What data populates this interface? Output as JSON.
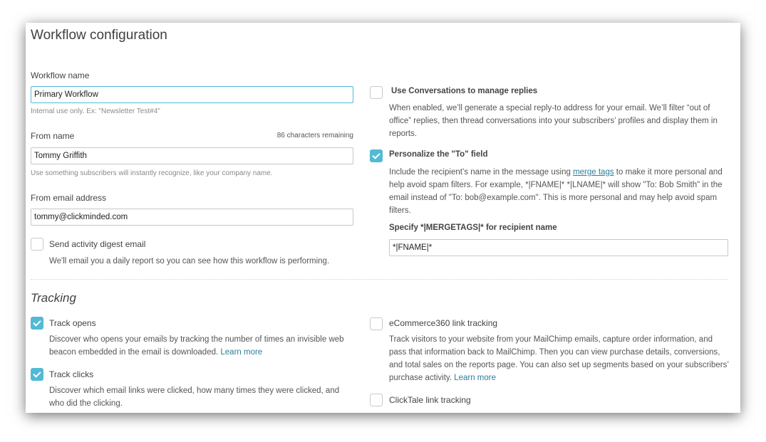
{
  "title": "Workflow configuration",
  "workflow_name": {
    "label": "Workflow name",
    "value": "Primary Workflow",
    "hint": "Internal use only. Ex: \"Newsletter Test#4\""
  },
  "from_name": {
    "label": "From name",
    "remaining": "86 characters remaining",
    "value": "Tommy Griffith",
    "hint": "Use something subscribers will instantly recognize, like your company name."
  },
  "from_email": {
    "label": "From email address",
    "value": "tommy@clickminded.com"
  },
  "digest": {
    "label": "Send activity digest email",
    "checked": false,
    "desc": "We'll email you a daily report so you can see how this workflow is performing."
  },
  "conversations": {
    "label": "Use Conversations to manage replies",
    "checked": false,
    "desc": "When enabled, we’ll generate a special reply-to address for your email. We’ll filter “out of office” replies, then thread conversations into your subscribers’ profiles and display them in reports."
  },
  "personalize": {
    "label": "Personalize the \"To\" field",
    "checked": true,
    "desc_before": "Include the recipient’s name in the message using ",
    "link": "merge tags",
    "desc_after": " to make it more personal and help avoid spam filters. For example, *|FNAME|* *|LNAME|* will show \"To: Bob Smith\" in the email instead of \"To: bob@example.com\". This is more personal and may help avoid spam filters.",
    "specify_label": "Specify *|MERGETAGS|* for recipient name",
    "specify_value": "*|FNAME|*"
  },
  "tracking": {
    "heading": "Tracking",
    "opens": {
      "label": "Track opens",
      "checked": true,
      "desc": "Discover who opens your emails by tracking the number of times an invisible web beacon embedded in the email is downloaded. ",
      "link": "Learn more"
    },
    "clicks": {
      "label": "Track clicks",
      "checked": true,
      "desc": "Discover which email links were clicked, how many times they were clicked, and who did the clicking."
    },
    "ecommerce": {
      "label": "eCommerce360 link tracking",
      "checked": false,
      "desc": "Track visitors to your website from your MailChimp emails, capture order information, and pass that information back to MailChimp. Then you can view purchase details, conversions, and total sales on the reports page. You can also set up segments based on your subscribers’ purchase activity. ",
      "link": "Learn more"
    },
    "clicktale": {
      "label": "ClickTale link tracking",
      "checked": false
    }
  },
  "colors": {
    "accent": "#52bad5",
    "link": "#2a7e9a"
  }
}
